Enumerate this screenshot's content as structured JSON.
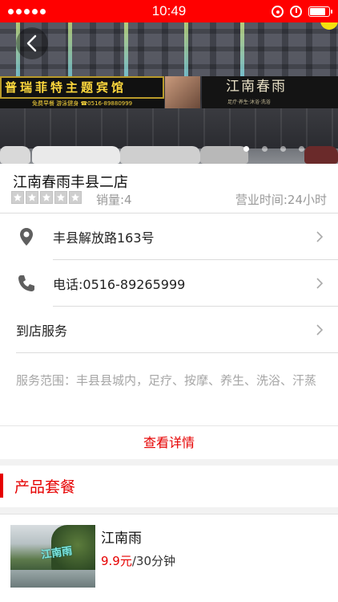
{
  "status_bar": {
    "time": "10:49",
    "battery_level": 0.85
  },
  "hero": {
    "sign_left": "普瑞菲特主题宾馆",
    "sign_left_sub": "免费早餐  游泳健身  ☎0516-89880999",
    "sign_right": "江南春雨",
    "sign_right_sub": "足疗·养生·沐浴·洗浴",
    "carousel_count": 4,
    "carousel_active": 0
  },
  "shop": {
    "name": "江南春雨丰县二店",
    "rating": 0,
    "rating_max": 5,
    "sales": "销量:4",
    "hours": "营业时间:24小时"
  },
  "info": {
    "address": "丰县解放路163号",
    "phone": "电话:0516-89265999",
    "service_label": "到店服务",
    "service_scope": "服务范围：丰县县城内，足疗、按摩、养生、洗浴、汗蒸",
    "detail_link": "查看详情"
  },
  "packages": {
    "section_title": "产品套餐",
    "items": [
      {
        "name": "江南雨",
        "price": "9.9元",
        "duration": "/30分钟",
        "thumb_text": "江南雨"
      }
    ]
  },
  "colors": {
    "brand": "#e60000",
    "status_bar": "#ff0000"
  },
  "icons": {
    "back": "back-chevron-icon",
    "location": "location-pin-icon",
    "phone": "phone-handset-icon",
    "chevron": "chevron-right-icon"
  }
}
